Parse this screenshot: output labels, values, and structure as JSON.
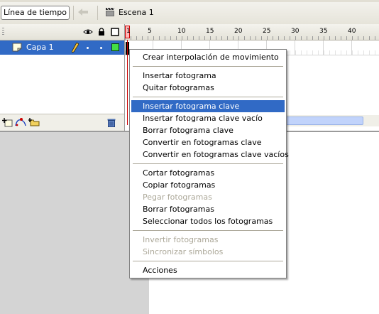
{
  "toolbar": {
    "timeline_button": "Línea de tiempo",
    "scene_label": "Escena 1"
  },
  "layers": {
    "layer_name": "Capa 1"
  },
  "ruler": {
    "labels": [
      "1",
      "5",
      "10",
      "15",
      "20",
      "25",
      "30",
      "35",
      "40"
    ]
  },
  "context_menu": {
    "items": [
      "Crear interpolación de movimiento",
      "Insertar fotograma",
      "Quitar fotogramas",
      "Insertar fotograma clave",
      "Insertar fotograma clave vacío",
      "Borrar fotograma clave",
      "Convertir en fotogramas clave",
      "Convertir en fotogramas clave vacíos",
      "Cortar fotogramas",
      "Copiar fotogramas",
      "Pegar fotogramas",
      "Borrar fotogramas",
      "Seleccionar todos los fotogramas",
      "Invertir fotogramas",
      "Sincronizar símbolos",
      "Acciones"
    ],
    "highlighted": "Insertar fotograma clave",
    "disabled": [
      "Pegar fotogramas",
      "Invertir fotogramas",
      "Sincronizar símbolos"
    ]
  },
  "colors": {
    "selection": "#316ac5",
    "disabled_text": "#aca899",
    "stage_gray": "#d4d4d4"
  }
}
